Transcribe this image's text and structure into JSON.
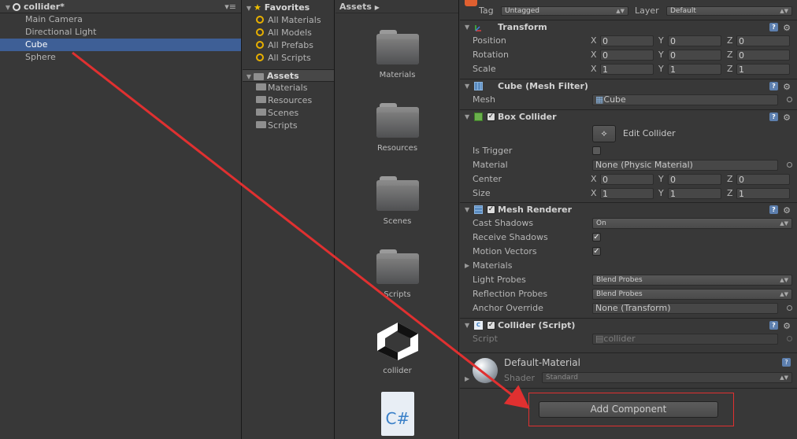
{
  "hierarchy": {
    "scene_name": "collider*",
    "items": [
      {
        "label": "Main Camera",
        "selected": false
      },
      {
        "label": "Directional Light",
        "selected": false
      },
      {
        "label": "Cube",
        "selected": true
      },
      {
        "label": "Sphere",
        "selected": false
      }
    ]
  },
  "project": {
    "favorites_label": "Favorites",
    "favorites": [
      "All Materials",
      "All Models",
      "All Prefabs",
      "All Scripts"
    ],
    "assets_label": "Assets",
    "folders": [
      "Materials",
      "Resources",
      "Scenes",
      "Scripts"
    ]
  },
  "grid": {
    "breadcrumb": "Assets",
    "items": [
      "Materials",
      "Resources",
      "Scenes",
      "Scripts",
      "collider"
    ]
  },
  "inspector": {
    "tag_label": "Tag",
    "tag_value": "Untagged",
    "layer_label": "Layer",
    "layer_value": "Default",
    "transform": {
      "title": "Transform",
      "position_label": "Position",
      "rotation_label": "Rotation",
      "scale_label": "Scale",
      "position": [
        "0",
        "0",
        "0"
      ],
      "rotation": [
        "0",
        "0",
        "0"
      ],
      "scale": [
        "1",
        "1",
        "1"
      ]
    },
    "mesh_filter": {
      "title": "Cube (Mesh Filter)",
      "mesh_label": "Mesh",
      "mesh_value": "Cube"
    },
    "box_collider": {
      "title": "Box Collider",
      "edit_label": "Edit Collider",
      "is_trigger_label": "Is Trigger",
      "material_label": "Material",
      "material_value": "None (Physic Material)",
      "center_label": "Center",
      "size_label": "Size",
      "center": [
        "0",
        "0",
        "0"
      ],
      "size": [
        "1",
        "1",
        "1"
      ]
    },
    "mesh_renderer": {
      "title": "Mesh Renderer",
      "cast_shadows_label": "Cast Shadows",
      "cast_shadows_value": "On",
      "receive_shadows_label": "Receive Shadows",
      "motion_vectors_label": "Motion Vectors",
      "materials_label": "Materials",
      "light_probes_label": "Light Probes",
      "light_probes_value": "Blend Probes",
      "reflection_probes_label": "Reflection Probes",
      "reflection_probes_value": "Blend Probes",
      "anchor_override_label": "Anchor Override",
      "anchor_override_value": "None (Transform)"
    },
    "collider_script": {
      "title": "Collider (Script)",
      "script_label": "Script",
      "script_value": "collider"
    },
    "material": {
      "name": "Default-Material",
      "shader_label": "Shader",
      "shader_value": "Standard"
    },
    "add_component_label": "Add Component",
    "axis_labels": [
      "X",
      "Y",
      "Z"
    ]
  },
  "colors": {
    "selection": "#3e5f96",
    "annotation_red": "#e03030"
  }
}
